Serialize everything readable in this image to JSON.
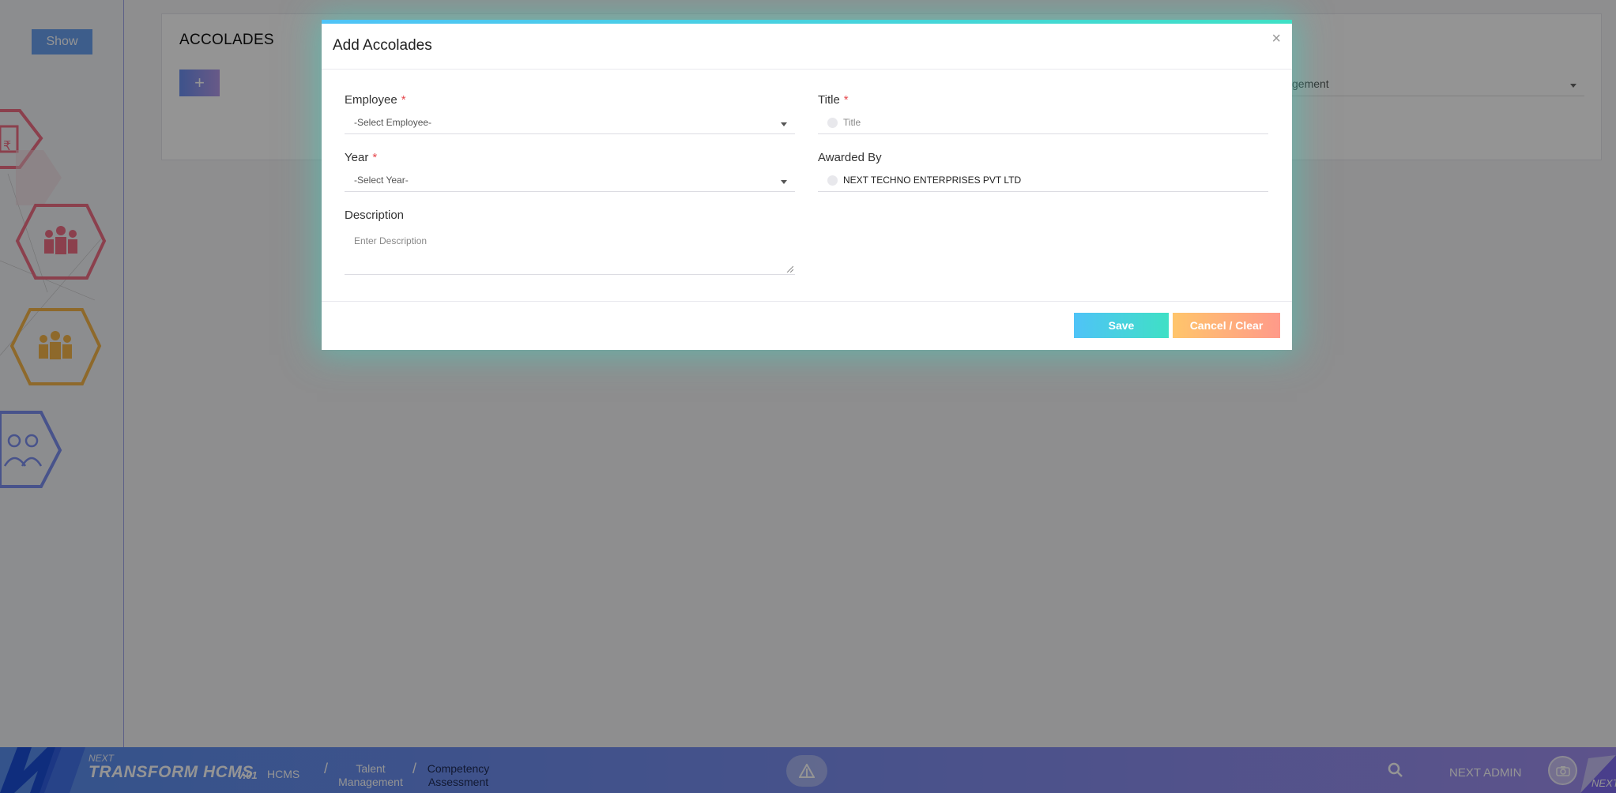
{
  "page": {
    "show_label": "Show",
    "title": "ACCOLADES",
    "add_label": "+",
    "partial_select_text": "gement"
  },
  "bottom_bar": {
    "brand_top": "NEXT",
    "brand": "TRANSFORM HCMS",
    "version": "V.01",
    "breadcrumb": [
      "HCMS",
      "Talent Management",
      "Competency Assessment"
    ],
    "separator": "/",
    "user": "NEXT ADMIN",
    "corner_label": "NEXT"
  },
  "modal": {
    "title": "Add Accolades",
    "close": "×",
    "fields": {
      "employee": {
        "label": "Employee",
        "required": "*",
        "value": "-Select Employee-"
      },
      "year": {
        "label": "Year",
        "required": "*",
        "value": "-Select Year-"
      },
      "title": {
        "label": "Title",
        "required": "*",
        "placeholder": "Title"
      },
      "awarded_by": {
        "label": "Awarded By",
        "value": "NEXT TECHNO ENTERPRISES PVT LTD"
      },
      "description": {
        "label": "Description",
        "placeholder": "Enter Description"
      }
    },
    "save_label": "Save",
    "cancel_label": "Cancel / Clear"
  },
  "colors": {
    "save": "#4fc3f7",
    "cancel": "#ffb07a",
    "required": "#e5484d",
    "bar": "#6a8ff0"
  },
  "icons": [
    "invoice-hex-icon",
    "team-hex-icon",
    "group-hex-icon",
    "people-hex-icon",
    "app-switch-icon",
    "search-icon",
    "camera-icon"
  ]
}
